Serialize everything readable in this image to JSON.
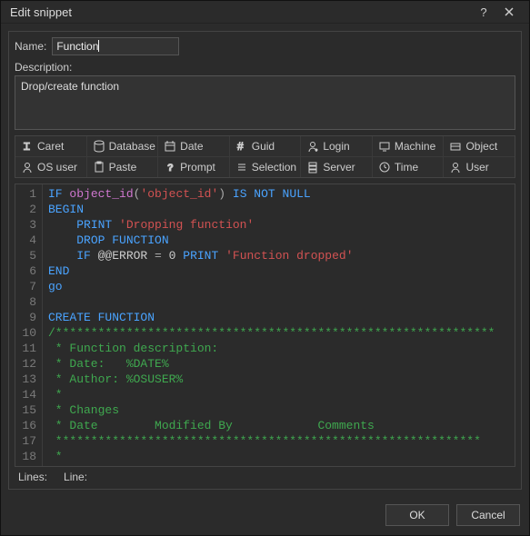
{
  "titlebar": {
    "title": "Edit snippet"
  },
  "labels": {
    "name": "Name:",
    "description": "Description:",
    "lines": "Lines:",
    "line": "Line:"
  },
  "fields": {
    "name_value": "Function",
    "description_value": "Drop/create function"
  },
  "toolbar": {
    "row1": [
      {
        "label": "Caret",
        "icon": "caret-icon"
      },
      {
        "label": "Database",
        "icon": "database-icon"
      },
      {
        "label": "Date",
        "icon": "calendar-icon"
      },
      {
        "label": "Guid",
        "icon": "hash-icon"
      },
      {
        "label": "Login",
        "icon": "login-icon"
      },
      {
        "label": "Machine",
        "icon": "machine-icon"
      },
      {
        "label": "Object",
        "icon": "object-icon"
      }
    ],
    "row2": [
      {
        "label": "OS user",
        "icon": "osuser-icon"
      },
      {
        "label": "Paste",
        "icon": "paste-icon"
      },
      {
        "label": "Prompt",
        "icon": "prompt-icon"
      },
      {
        "label": "Selection",
        "icon": "selection-icon"
      },
      {
        "label": "Server",
        "icon": "server-icon"
      },
      {
        "label": "Time",
        "icon": "time-icon"
      },
      {
        "label": "User",
        "icon": "user-icon"
      }
    ]
  },
  "code_lines": [
    {
      "n": 1,
      "seg": [
        [
          "kw",
          "IF"
        ],
        [
          "",
          " "
        ],
        [
          "fn",
          "object_id"
        ],
        [
          "op",
          "("
        ],
        [
          "str",
          "'object_id'"
        ],
        [
          "op",
          ")"
        ],
        [
          "",
          " "
        ],
        [
          "kw",
          "IS NOT NULL"
        ]
      ]
    },
    {
      "n": 2,
      "seg": [
        [
          "kw",
          "BEGIN"
        ]
      ]
    },
    {
      "n": 3,
      "seg": [
        [
          "",
          "    "
        ],
        [
          "kw",
          "PRINT"
        ],
        [
          "",
          " "
        ],
        [
          "str",
          "'Dropping function'"
        ]
      ]
    },
    {
      "n": 4,
      "seg": [
        [
          "",
          "    "
        ],
        [
          "kw",
          "DROP FUNCTION"
        ]
      ]
    },
    {
      "n": 5,
      "seg": [
        [
          "",
          "    "
        ],
        [
          "kw",
          "IF"
        ],
        [
          "",
          " @@ERROR "
        ],
        [
          "op",
          "="
        ],
        [
          "",
          " 0 "
        ],
        [
          "kw",
          "PRINT"
        ],
        [
          "",
          " "
        ],
        [
          "str",
          "'Function dropped'"
        ]
      ]
    },
    {
      "n": 6,
      "seg": [
        [
          "kw",
          "END"
        ]
      ]
    },
    {
      "n": 7,
      "seg": [
        [
          "kw",
          "go"
        ]
      ]
    },
    {
      "n": 8,
      "seg": [
        [
          "",
          ""
        ]
      ]
    },
    {
      "n": 9,
      "seg": [
        [
          "kw",
          "CREATE FUNCTION"
        ]
      ]
    },
    {
      "n": 10,
      "seg": [
        [
          "cmt",
          "/**************************************************************"
        ]
      ]
    },
    {
      "n": 11,
      "seg": [
        [
          "cmt",
          " * Function description:"
        ]
      ]
    },
    {
      "n": 12,
      "seg": [
        [
          "cmt",
          " * Date:   %DATE%"
        ]
      ]
    },
    {
      "n": 13,
      "seg": [
        [
          "cmt",
          " * Author: %OSUSER%"
        ]
      ]
    },
    {
      "n": 14,
      "seg": [
        [
          "cmt",
          " *"
        ]
      ]
    },
    {
      "n": 15,
      "seg": [
        [
          "cmt",
          " * Changes"
        ]
      ]
    },
    {
      "n": 16,
      "seg": [
        [
          "cmt",
          " * Date        Modified By            Comments"
        ]
      ]
    },
    {
      "n": 17,
      "seg": [
        [
          "cmt",
          " ************************************************************"
        ]
      ]
    },
    {
      "n": 18,
      "seg": [
        [
          "cmt",
          " *"
        ]
      ]
    }
  ],
  "buttons": {
    "ok": "OK",
    "cancel": "Cancel"
  }
}
